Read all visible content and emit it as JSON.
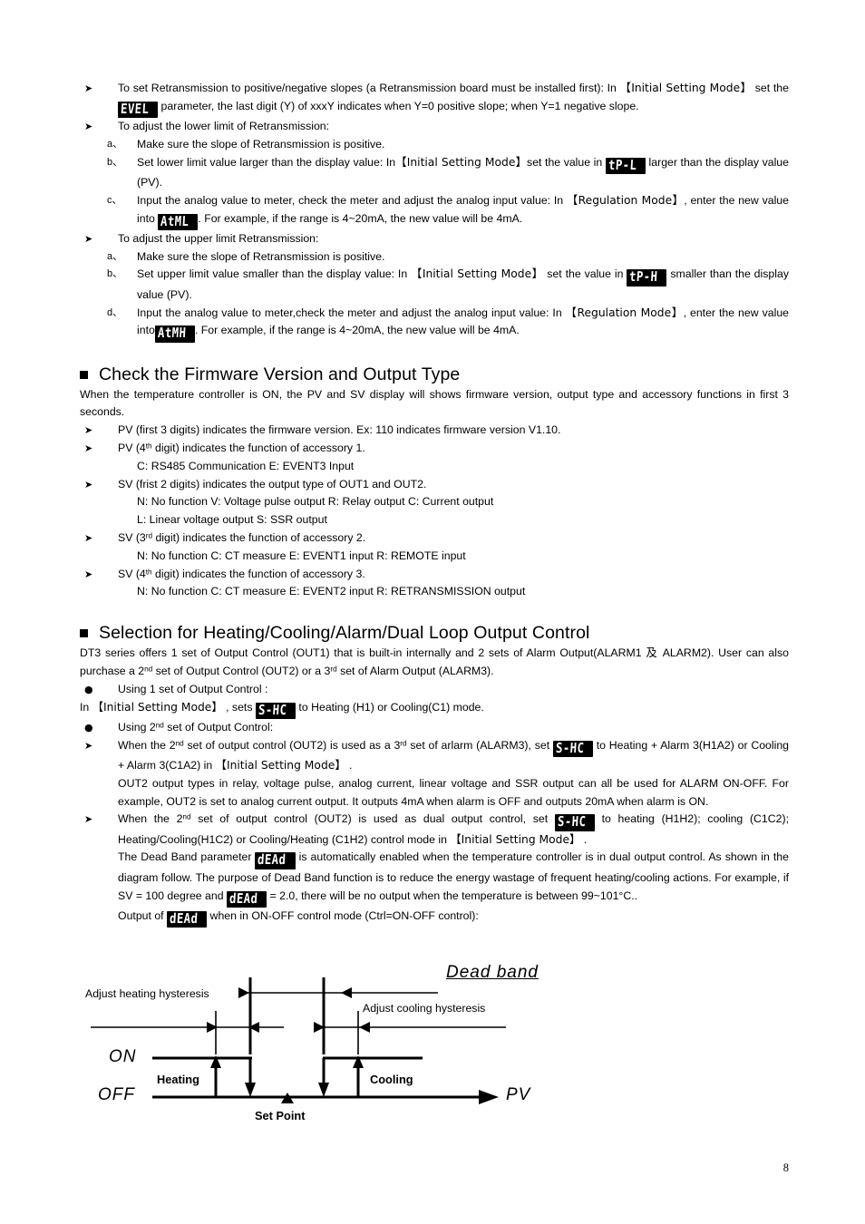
{
  "page": {
    "number": "8"
  },
  "retransmission": {
    "items": [
      {
        "marker": "➢",
        "segments": [
          {
            "t": "text",
            "v": "To set Retransmission to positive/negative slopes (a Retransmission board must be installed first): In  "
          },
          {
            "t": "brk",
            "v": "【Initial Setting Mode】"
          },
          {
            "t": "text",
            "v": "  set the "
          },
          {
            "t": "led",
            "v": "EVEL"
          },
          {
            "t": "text",
            "v": " parameter, the last digit (Y) of xxxY indicates when Y=0 positive slope; when Y=1 negative slope."
          }
        ]
      },
      {
        "marker": "➢",
        "segments": [
          {
            "t": "text",
            "v": "To adjust the lower limit of Retransmission:"
          }
        ]
      }
    ],
    "lower_steps": [
      {
        "marker": "a、",
        "segments": [
          {
            "t": "text",
            "v": "Make sure the slope of Retransmission is positive."
          }
        ]
      },
      {
        "marker": "b、",
        "segments": [
          {
            "t": "text",
            "v": "Set lower limit value larger than the display value: In"
          },
          {
            "t": "brk",
            "v": "【Initial Setting Mode】"
          },
          {
            "t": "text",
            "v": "set the value in "
          },
          {
            "t": "led",
            "v": "tP-L"
          },
          {
            "t": "text",
            "v": " larger than the display value (PV)."
          }
        ]
      },
      {
        "marker": "c、",
        "segments": [
          {
            "t": "text",
            "v": "Input the analog value to meter, check the meter and adjust the analog input value: In  "
          },
          {
            "t": "brk",
            "v": "【Regulation Mode】"
          },
          {
            "t": "text",
            "v": ", enter the new value into "
          },
          {
            "t": "led",
            "v": "AtML"
          },
          {
            "t": "text",
            "v": ". For example, if the range is 4~20mA, the new value will be 4mA."
          }
        ]
      }
    ],
    "upper_header": {
      "marker": "➢",
      "segments": [
        {
          "t": "text",
          "v": "To adjust the upper limit Retransmission:"
        }
      ]
    },
    "upper_steps": [
      {
        "marker": "a、",
        "segments": [
          {
            "t": "text",
            "v": "Make sure the slope of Retransmission is positive."
          }
        ]
      },
      {
        "marker": "b、",
        "segments": [
          {
            "t": "text",
            "v": "Set upper limit value smaller than the display value: In  "
          },
          {
            "t": "brk",
            "v": "【Initial Setting Mode】"
          },
          {
            "t": "text",
            "v": " set the value in "
          },
          {
            "t": "led",
            "v": "tP-H"
          },
          {
            "t": "text",
            "v": " smaller than the display value (PV)."
          }
        ]
      },
      {
        "marker": "d、",
        "segments": [
          {
            "t": "text",
            "v": "Input the analog value to meter,check the meter and adjust the analog input value: In  "
          },
          {
            "t": "brk",
            "v": "【Regulation Mode】"
          },
          {
            "t": "text",
            "v": ", enter the new value into"
          },
          {
            "t": "led",
            "v": "AtMH"
          },
          {
            "t": "text",
            "v": ". For example, if the range is 4~20mA, the new value will be 4mA."
          }
        ]
      }
    ]
  },
  "firmware": {
    "heading": "Check the Firmware Version and Output Type",
    "intro": "When the temperature controller is ON, the PV and SV display will shows firmware version, output type and accessory functions in first 3 seconds.",
    "items": [
      {
        "marker": "➢",
        "segments": [
          {
            "t": "text",
            "v": "PV (first 3 digits) indicates the firmware version. Ex: 110 indicates firmware version V1.10."
          }
        ]
      },
      {
        "marker": "➢",
        "segments": [
          {
            "t": "text",
            "v": "PV (4"
          },
          {
            "t": "sup",
            "v": "th"
          },
          {
            "t": "text",
            "v": " digit) indicates the function of accessory 1."
          }
        ],
        "note": "C: RS485 Communication     E: EVENT3 Input"
      },
      {
        "marker": "➢",
        "segments": [
          {
            "t": "text",
            "v": "SV (frist 2 digits) indicates the output type of OUT1 and OUT2."
          }
        ],
        "note": "N: No function     V: Voltage pulse output     R: Relay output     C: Current output",
        "note2": "L: Linear voltage output     S: SSR output"
      },
      {
        "marker": "➢",
        "segments": [
          {
            "t": "text",
            "v": "SV (3"
          },
          {
            "t": "sup",
            "v": "rd"
          },
          {
            "t": "text",
            "v": " digit) indicates the function of accessory 2."
          }
        ],
        "note": "N: No function     C: CT measure     E: EVENT1 input     R: REMOTE input"
      },
      {
        "marker": "➢",
        "segments": [
          {
            "t": "text",
            "v": "SV (4"
          },
          {
            "t": "sup",
            "v": "th"
          },
          {
            "t": "text",
            "v": " digit) indicates the function of accessory 3."
          }
        ],
        "note": "N: No function     C: CT measure     E: EVENT2 input     R: RETRANSMISSION output"
      }
    ]
  },
  "selection": {
    "heading": "Selection for Heating/Cooling/Alarm/Dual Loop Output Control",
    "intro_segments": [
      {
        "t": "text",
        "v": "DT3 series offers 1 set of Output Control (OUT1) that is built-in internally and 2 sets of Alarm Output(ALARM1 "
      },
      {
        "t": "cjk",
        "v": "及"
      },
      {
        "t": "text",
        "v": " ALARM2). User can also purchase a 2"
      },
      {
        "t": "sup",
        "v": "nd"
      },
      {
        "t": "text",
        "v": " set of Output Control (OUT2) or a 3"
      },
      {
        "t": "sup",
        "v": "rd"
      },
      {
        "t": "text",
        "v": " set of Alarm Output (ALARM3)."
      }
    ],
    "bullet1": {
      "marker": "●",
      "segments": [
        {
          "t": "text",
          "v": "Using 1 set of Output Control :"
        }
      ]
    },
    "line1_segments": [
      {
        "t": "text",
        "v": "In "
      },
      {
        "t": "brk",
        "v": "【Initial Setting Mode】"
      },
      {
        "t": "text",
        "v": " , sets "
      },
      {
        "t": "led",
        "v": "S-HC"
      },
      {
        "t": "text",
        "v": " to Heating (H1) or Cooling(C1) mode."
      }
    ],
    "bullet2": {
      "marker": "●",
      "segments": [
        {
          "t": "text",
          "v": "Using 2"
        },
        {
          "t": "sup",
          "v": "nd"
        },
        {
          "t": "text",
          "v": " set of Output Control:"
        }
      ]
    },
    "item_alarm3": {
      "marker": "➢",
      "segments": [
        {
          "t": "text",
          "v": "When the 2"
        },
        {
          "t": "sup",
          "v": "nd"
        },
        {
          "t": "text",
          "v": " set of output control (OUT2) is used as a 3"
        },
        {
          "t": "sup",
          "v": "rd"
        },
        {
          "t": "text",
          "v": " set of arlarm (ALARM3), set "
        },
        {
          "t": "led",
          "v": "S-HC"
        },
        {
          "t": "text",
          "v": " to Heating + Alarm 3(H1A2) or Cooling + Alarm 3(C1A2) in  "
        },
        {
          "t": "brk",
          "v": "【Initial Setting Mode】"
        },
        {
          "t": "text",
          "v": " ."
        }
      ]
    },
    "para_out2": "OUT2 output types in relay, voltage pulse, analog current, linear voltage and SSR output can all be used for ALARM ON-OFF. For example, OUT2 is set to analog current output. It outputs 4mA when alarm is OFF and outputs 20mA when alarm is ON.",
    "item_dual": {
      "marker": "➢",
      "segments": [
        {
          "t": "text",
          "v": "When the 2"
        },
        {
          "t": "sup",
          "v": "nd"
        },
        {
          "t": "text",
          "v": " set of output control (OUT2) is used as dual output control, set "
        },
        {
          "t": "led",
          "v": "S-HC"
        },
        {
          "t": "text",
          "v": " to heating (H1H2); cooling (C1C2); Heating/Cooling(H1C2) or Cooling/Heating (C1H2) control mode in "
        },
        {
          "t": "brk",
          "v": "【Initial Setting Mode】"
        },
        {
          "t": "text",
          "v": " ."
        }
      ]
    },
    "para_deadband_segments": [
      {
        "t": "text",
        "v": "The Dead Band parameter "
      },
      {
        "t": "led",
        "v": "dEAd"
      },
      {
        "t": "text",
        "v": " is automatically enabled when the temperature controller is in dual output control. As shown in the diagram follow. The purpose of Dead Band function is to reduce the energy wastage of frequent heating/cooling actions. For example, if SV = 100 degree and "
      },
      {
        "t": "led",
        "v": "dEAd"
      },
      {
        "t": "text",
        "v": " = 2.0, there will be no output when the temperature is between 99~101°C.."
      }
    ],
    "para_output_segments": [
      {
        "t": "text",
        "v": "Output of "
      },
      {
        "t": "led",
        "v": "dEAd"
      },
      {
        "t": "text",
        "v": " when in ON-OFF control mode (Ctrl=ON-OFF control):"
      }
    ]
  },
  "diagram": {
    "dead_band_label": "Dead band",
    "heating_hysteresis_label": "Adjust heating hysteresis",
    "cooling_hysteresis_label": "Adjust cooling hysteresis",
    "on_label": "ON",
    "off_label": "OFF",
    "heating_label": "Heating",
    "cooling_label": "Cooling",
    "set_point_label": "Set Point",
    "pv_label": "PV"
  }
}
